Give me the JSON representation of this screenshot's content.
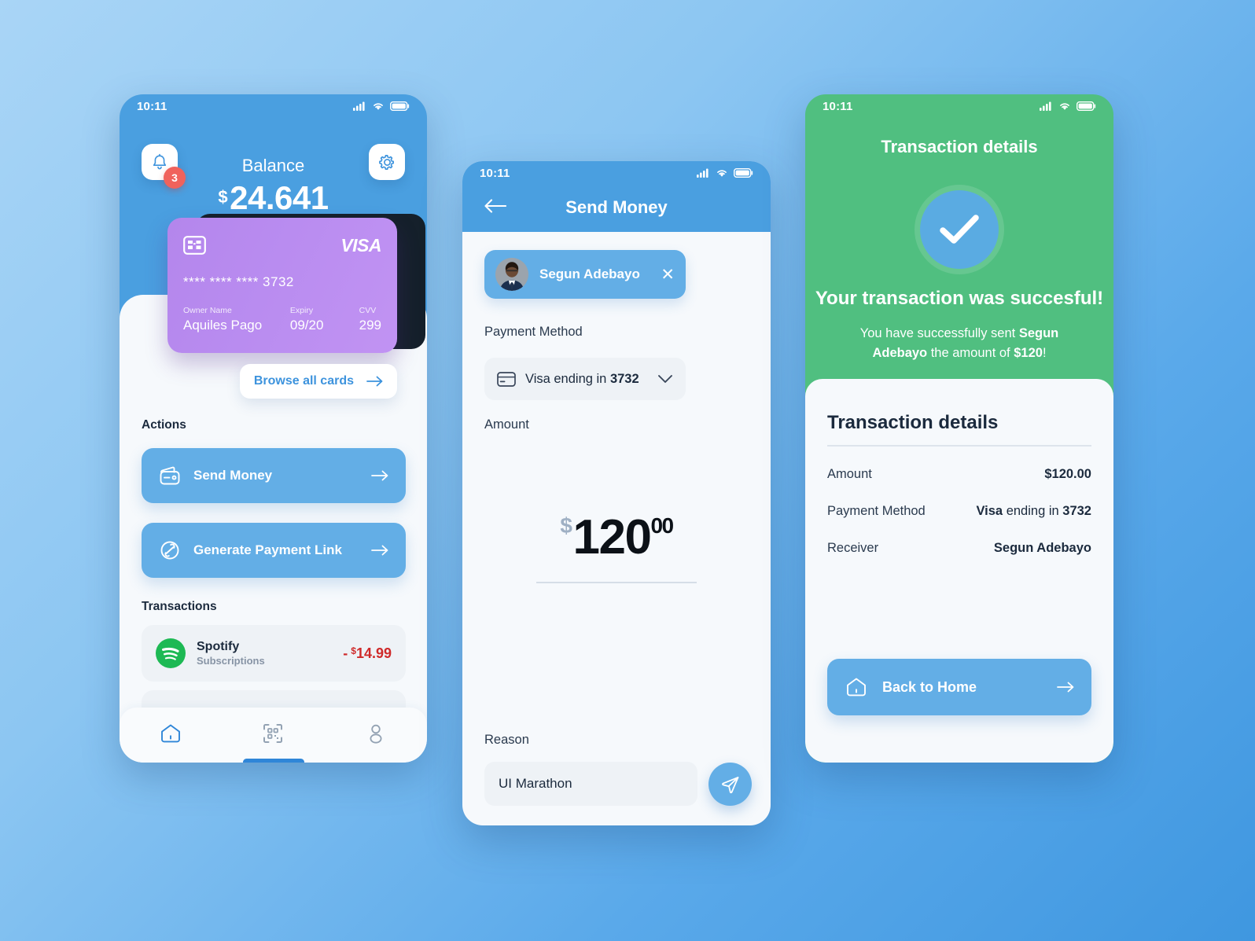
{
  "theme": {
    "bg_start": "#a9d5f6",
    "bg_end": "#3f97e0",
    "primary_blue": "#4a9fe0",
    "button_blue": "#63aee6",
    "success_green": "#50bf80",
    "card_purple": "#b98cf0",
    "danger_red": "#cf2a2a",
    "badge_red": "#f0625c",
    "spotify_green": "#1db954"
  },
  "home": {
    "statusbar": {
      "time": "10:11",
      "signal_icon": "cellular-signal-icon",
      "wifi_icon": "wifi-icon",
      "battery_icon": "battery-icon"
    },
    "bell_icon": "bell-icon",
    "notification_count": "3",
    "gear_icon": "gear-icon",
    "balance_label": "Balance",
    "balance_currency": "$",
    "balance_value": "24.641",
    "card": {
      "chip_icon": "card-chip-icon",
      "brand": "VISA",
      "number": "**** **** **** 3732",
      "owner_label": "Owner Name",
      "owner_value": "Aquiles Pago",
      "expiry_label": "Expiry",
      "expiry_value": "09/20",
      "cvv_label": "CVV",
      "cvv_value": "299"
    },
    "browse_all_cards": "Browse all cards",
    "actions_title": "Actions",
    "actions": [
      {
        "label": "Send Money",
        "icon": "wallet-icon"
      },
      {
        "label": "Generate Payment Link",
        "icon": "link-icon"
      }
    ],
    "transactions_title": "Transactions",
    "transactions": [
      {
        "name": "Spotify",
        "category": "Subscriptions",
        "sign": "-",
        "currency": "$",
        "amount": "14.99",
        "icon": "spotify-icon"
      }
    ],
    "nav": [
      {
        "name": "home",
        "icon": "home-icon",
        "active": true
      },
      {
        "name": "scan",
        "icon": "qr-code-icon",
        "active": false
      },
      {
        "name": "profile",
        "icon": "person-icon",
        "active": false
      }
    ]
  },
  "send": {
    "statusbar": {
      "time": "10:11",
      "signal_icon": "cellular-signal-icon",
      "wifi_icon": "wifi-icon",
      "battery_icon": "battery-icon"
    },
    "back_icon": "arrow-left-icon",
    "title": "Send Money",
    "recipient": {
      "name": "Segun Adebayo",
      "avatar": "recipient-avatar",
      "remove_icon": "close-icon"
    },
    "payment_method_label": "Payment Method",
    "payment_method": {
      "prefix": "Visa ending in ",
      "last4": "3732",
      "icon": "credit-card-icon",
      "chevron": "chevron-down-icon"
    },
    "amount_label": "Amount",
    "amount": {
      "currency": "$",
      "whole": "120",
      "cents": "00"
    },
    "reason_label": "Reason",
    "reason_value": "UI Marathon",
    "reason_placeholder": "Reason",
    "send_icon": "paper-plane-icon"
  },
  "success": {
    "statusbar": {
      "time": "10:11",
      "signal_icon": "cellular-signal-icon",
      "wifi_icon": "wifi-icon",
      "battery_icon": "battery-icon"
    },
    "header_title": "Transaction details",
    "check_icon": "check-mark-icon",
    "headline": "Your transaction was succesful!",
    "subtext_pre": "You have successfully sent ",
    "subtext_name": "Segun Adebayo",
    "subtext_mid": " the amount of ",
    "subtext_amount": "$120",
    "subtext_post": "!",
    "details_title": "Transaction details",
    "details": [
      {
        "label": "Amount",
        "value": "$120.00",
        "bold": true
      },
      {
        "label": "Payment Method",
        "value_prefix": "Visa",
        "value_mid": " ending in ",
        "value_suffix": "3732"
      },
      {
        "label": "Receiver",
        "value": "Segun Adebayo",
        "bold": true
      }
    ],
    "back_button": {
      "label": "Back to Home",
      "icon": "home-icon",
      "arrow": "arrow-right-icon"
    }
  }
}
